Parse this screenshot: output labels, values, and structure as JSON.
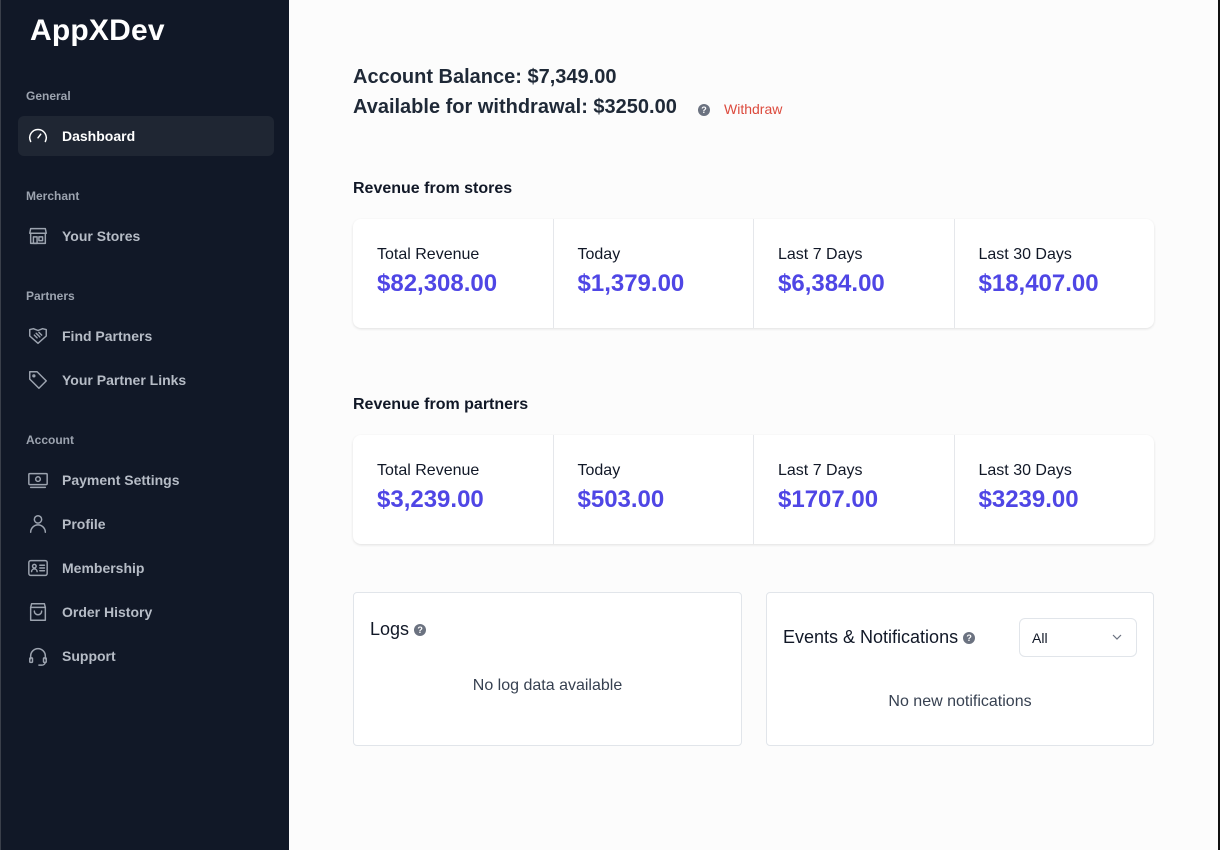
{
  "app": {
    "title": "AppXDev"
  },
  "sidebar": {
    "sections": [
      {
        "label": "General",
        "items": [
          {
            "label": "Dashboard",
            "icon": "gauge-icon",
            "active": true
          }
        ]
      },
      {
        "label": "Merchant",
        "items": [
          {
            "label": "Your Stores",
            "icon": "store-icon"
          }
        ]
      },
      {
        "label": "Partners",
        "items": [
          {
            "label": "Find Partners",
            "icon": "handshake-icon"
          },
          {
            "label": "Your Partner Links",
            "icon": "tag-icon"
          }
        ]
      },
      {
        "label": "Account",
        "items": [
          {
            "label": "Payment Settings",
            "icon": "banknote-icon"
          },
          {
            "label": "Profile",
            "icon": "user-icon"
          },
          {
            "label": "Membership",
            "icon": "id-card-icon"
          },
          {
            "label": "Order History",
            "icon": "shopping-bag-icon"
          },
          {
            "label": "Support",
            "icon": "headset-icon"
          }
        ]
      }
    ]
  },
  "balance": {
    "account_balance": "Account Balance: $7,349.00",
    "available": "Available for withdrawal: $3250.00",
    "withdraw_label": "Withdraw",
    "help_glyph": "?"
  },
  "stores": {
    "title": "Revenue from stores",
    "stats": [
      {
        "label": "Total Revenue",
        "value": "$82,308.00"
      },
      {
        "label": "Today",
        "value": "$1,379.00"
      },
      {
        "label": "Last 7 Days",
        "value": "$6,384.00"
      },
      {
        "label": "Last 30 Days",
        "value": "$18,407.00"
      }
    ]
  },
  "partners": {
    "title": "Revenue from partners",
    "stats": [
      {
        "label": "Total Revenue",
        "value": "$3,239.00"
      },
      {
        "label": "Today",
        "value": "$503.00"
      },
      {
        "label": "Last 7 Days",
        "value": "$1707.00"
      },
      {
        "label": "Last 30 Days",
        "value": "$3239.00"
      }
    ]
  },
  "logs": {
    "title": "Logs",
    "empty": "No log data available"
  },
  "events": {
    "title": "Events & Notifications",
    "filter_selected": "All",
    "empty": "No new notifications"
  },
  "colors": {
    "accent": "#4f46e5",
    "danger": "#dc4a3d",
    "sidebar_bg": "#111827"
  }
}
